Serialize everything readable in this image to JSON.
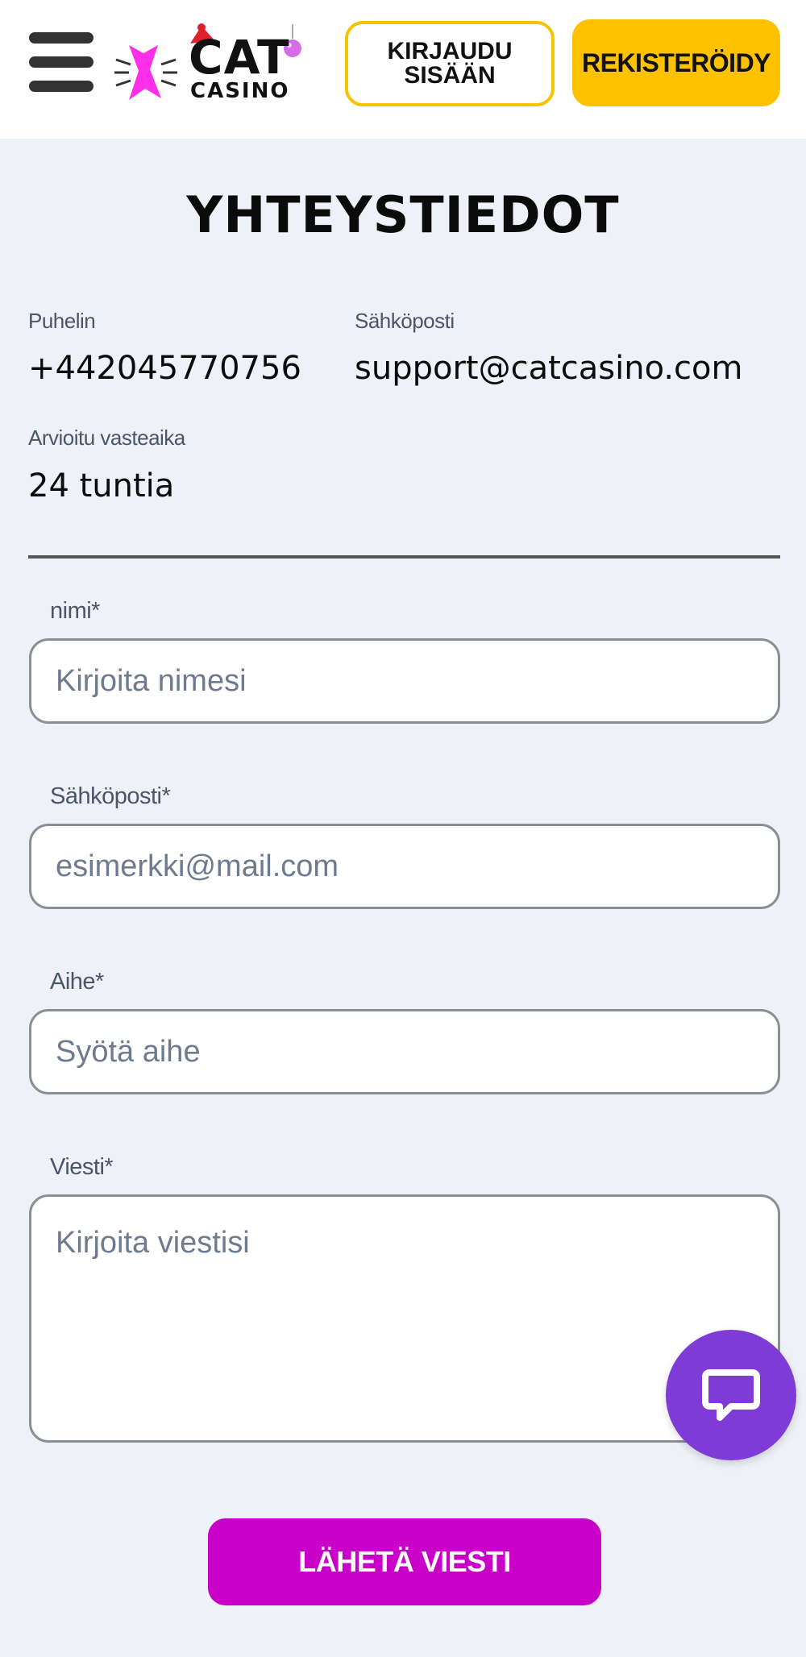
{
  "header": {
    "logo_main": "CAT",
    "logo_sub": "CASINO",
    "login_label": "KIRJAUDU\nSISÄÄN",
    "register_label": "REKISTERÖIDY"
  },
  "main": {
    "title": "YHTEYSTIEDOT",
    "contact": {
      "phone_label": "Puhelin",
      "phone_value": "+442045770756",
      "email_label": "Sähköposti",
      "email_value": "support@catcasino.com",
      "response_label": "Arvioitu vasteaika",
      "response_value": "24 tuntia"
    },
    "form": {
      "name_label": "nimi*",
      "name_placeholder": "Kirjoita nimesi",
      "email_label": "Sähköposti*",
      "email_placeholder": "esimerkki@mail.com",
      "subject_label": "Aihe*",
      "subject_placeholder": "Syötä aihe",
      "message_label": "Viesti*",
      "message_placeholder": "Kirjoita viestisi",
      "submit_label": "LÄHETÄ VIESTI"
    }
  },
  "colors": {
    "accent_yellow": "#fcc200",
    "accent_magenta": "#c800c8",
    "chat_purple": "#7f3bd6",
    "page_bg": "#eef2f8"
  },
  "icons": {
    "menu": "hamburger-icon",
    "logo": "cat-logo-icon",
    "chat": "chat-bubble-icon"
  }
}
